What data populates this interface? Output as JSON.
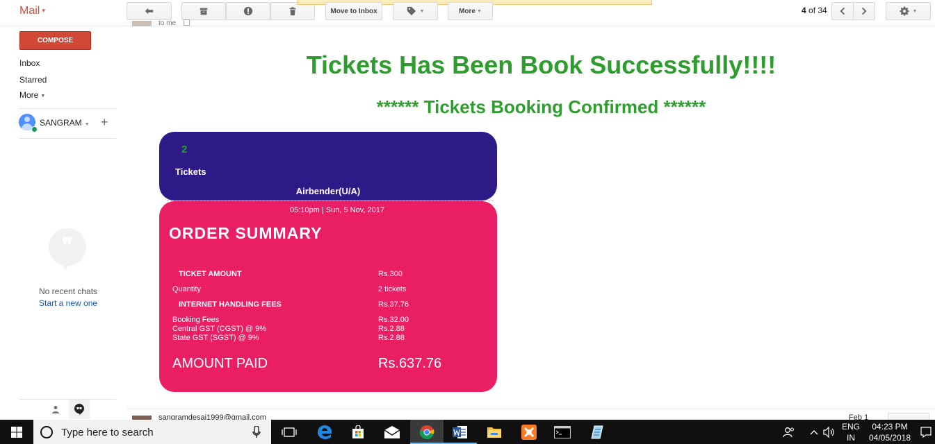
{
  "app": {
    "title": "Mail",
    "caret": "▾"
  },
  "toolbar": {
    "move_to_inbox_label": "Move to Inbox",
    "more_label": "More",
    "counter_current": "4",
    "counter_of": "of 34"
  },
  "sidebar": {
    "compose_label": "COMPOSE",
    "items": [
      {
        "label": "Inbox"
      },
      {
        "label": "Starred"
      },
      {
        "label": "More"
      }
    ],
    "account_name": "SANGRAM",
    "no_chats_text": "No recent chats",
    "start_new_text": "Start a new one"
  },
  "message": {
    "to_text": "to me",
    "headline": "Tickets Has Been Book Successfully!!!!",
    "subheadline": "****** Tickets Booking Confirmed ******"
  },
  "ticket": {
    "count": "2",
    "count_label": "Tickets",
    "movie": "Airbender(U/A)",
    "showtime": "05:10pm | Sun, 5 Nov, 2017",
    "summary_title": "ORDER SUMMARY",
    "rows": [
      {
        "label": "TICKET AMOUNT",
        "value": "Rs.300"
      },
      {
        "label": "Quantity",
        "value": "2 tickets"
      },
      {
        "label": "INTERNET HANDLING FEES",
        "value": "Rs.37.76"
      },
      {
        "label": "Booking Fees",
        "value": "Rs.32.00"
      },
      {
        "label": "Central GST (CGST) @ 9%",
        "value": "Rs.2.88"
      },
      {
        "label": "State GST (SGST) @ 9%",
        "value": "Rs.2.88"
      }
    ],
    "amount_paid_label": "AMOUNT PAID",
    "amount_paid_value": "Rs.637.76"
  },
  "next_message": {
    "from": "sangramdesai1999@gmail.com",
    "date": "Feb 1"
  },
  "taskbar": {
    "search_placeholder": "Type here to search",
    "lang_top": "ENG",
    "lang_bottom": "IN",
    "time": "04:23 PM",
    "date": "04/05/2018"
  },
  "colors": {
    "ticket_top_bg": "#2d1a87",
    "ticket_bottom_bg": "#e91e63",
    "headline_green": "#2d9e2d",
    "compose_red": "#d14836"
  }
}
